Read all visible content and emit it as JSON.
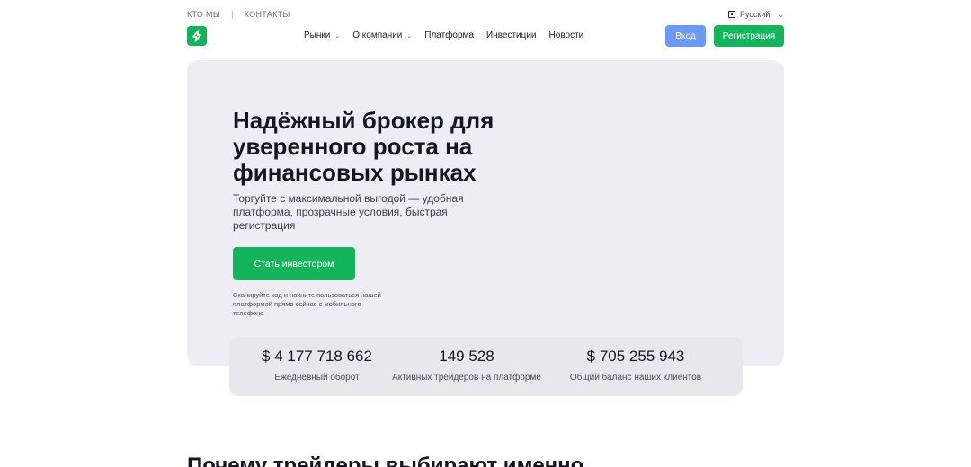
{
  "topbar": {
    "links": [
      "КТО МЫ",
      "КОНТАКТЫ"
    ],
    "separator": "|",
    "language": "Русский"
  },
  "nav": {
    "items": [
      {
        "label": "Рынки",
        "has_dropdown": true
      },
      {
        "label": "О компании",
        "has_dropdown": true
      },
      {
        "label": "Платформа",
        "has_dropdown": false
      },
      {
        "label": "Инвестиции",
        "has_dropdown": false
      },
      {
        "label": "Новости",
        "has_dropdown": false
      }
    ],
    "login_label": "Вход",
    "register_label": "Регистрация"
  },
  "hero": {
    "title": "Надёжный брокер для уверенного роста на финансовых рынках",
    "subtitle": "Торгуйте с максимальной выгодой — удобная платформа, прозрачные условия, быстрая регистрация",
    "cta_label": "Стать инвестором",
    "qr_note": "Сканируйте код и начните пользоваться нашей платформой прямо сейчас с мобильного телефона"
  },
  "stats": [
    {
      "value": "$ 4 177 718 662",
      "label": "Ежедневный оборот"
    },
    {
      "value": "149 528",
      "label": "Активных трейдеров на платформе"
    },
    {
      "value": "$ 705 255 943",
      "label": "Общий баланс наших клиентов"
    }
  ],
  "section": {
    "title": "Почему трейдеры выбирают именно"
  },
  "icons": {
    "logo": "lightning-bolt-logo-icon",
    "language": "globe-icon",
    "dropdown": "chevron-down-icon"
  },
  "colors": {
    "brand_green": "#14b45c",
    "login_blue": "#6b9af5",
    "hero_bg": "#ededf3",
    "stats_bg": "#e8e8ec"
  }
}
